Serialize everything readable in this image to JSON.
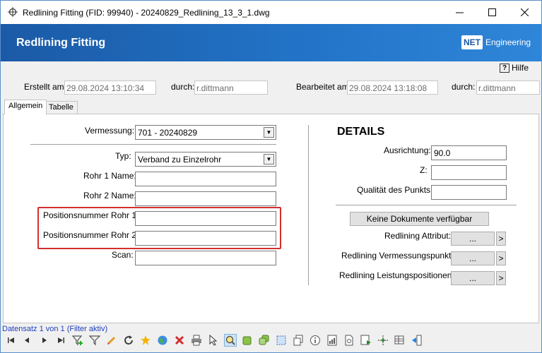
{
  "window": {
    "title": "Redlining Fitting (FID: 99940) - 20240829_Redlining_13_3_1.dwg",
    "minimize_label": "—",
    "maximize_label": "☐",
    "close_label": "✕"
  },
  "header": {
    "title": "Redlining Fitting",
    "logo_net": "NET",
    "logo_engineering": "Engineering"
  },
  "help": {
    "label": "Hilfe",
    "icon": "?"
  },
  "meta": {
    "created_label": "Erstellt am:",
    "created_value": "29.08.2024 13:10:34",
    "created_by_label": "durch:",
    "created_by_value": "r.dittmann",
    "edited_label": "Bearbeitet am:",
    "edited_value": "29.08.2024 13:18:08",
    "edited_by_label": "durch:",
    "edited_by_value": "r.dittmann"
  },
  "tabs": [
    {
      "label": "Allgemein",
      "active": true
    },
    {
      "label": "Tabelle",
      "active": false
    }
  ],
  "form": {
    "vermessung_label": "Vermessung:",
    "vermessung_value": "701 - 20240829",
    "typ_label": "Typ:",
    "typ_value": "Verband zu Einzelrohr",
    "rohr1_label": "Rohr 1 Name:",
    "rohr1_value": "",
    "rohr2_label": "Rohr 2 Name:",
    "rohr2_value": "",
    "pos1_label": "Positionsnummer Rohr 1:",
    "pos1_value": "",
    "pos2_label": "Positionsnummer Rohr 2:",
    "pos2_value": "",
    "scan_label": "Scan:",
    "scan_value": ""
  },
  "details": {
    "title": "DETAILS",
    "ausrichtung_label": "Ausrichtung:",
    "ausrichtung_value": "90.0",
    "z_label": "Z:",
    "z_value": "",
    "qualitaet_label": "Qualität des Punkts:",
    "qualitaet_value": "",
    "dokumente_button": "Keine Dokumente verfügbar",
    "attribut_label": "Redlining Attribut:",
    "vermessungspunkt_label": "Redlining Vermessungspunkt:",
    "leistungspositionen_label": "Redlining Leistungspositionen:",
    "ellipsis": "...",
    "go": ">"
  },
  "status": {
    "text": "Datensatz 1 von 1 (Filter aktiv)"
  },
  "colors": {
    "banner": "#1b5aa6",
    "highlight_box": "#d32f2f",
    "status_text": "#1f3fbf"
  },
  "toolbar": {
    "icons": [
      "first-record-icon",
      "prev-record-icon",
      "next-record-icon",
      "last-record-icon",
      "filter-add-icon",
      "filter-icon",
      "edit-pencil-icon",
      "refresh-icon",
      "new-star-icon",
      "globe-icon",
      "delete-icon",
      "print-icon",
      "select-cursor-icon",
      "zoom-icon",
      "layer-green-icon",
      "layer-copy-icon",
      "select-area-icon",
      "copy-icon",
      "info-icon",
      "report-icon",
      "document-icon",
      "export-icon",
      "move-icon",
      "table-edit-icon",
      "exit-icon"
    ]
  }
}
